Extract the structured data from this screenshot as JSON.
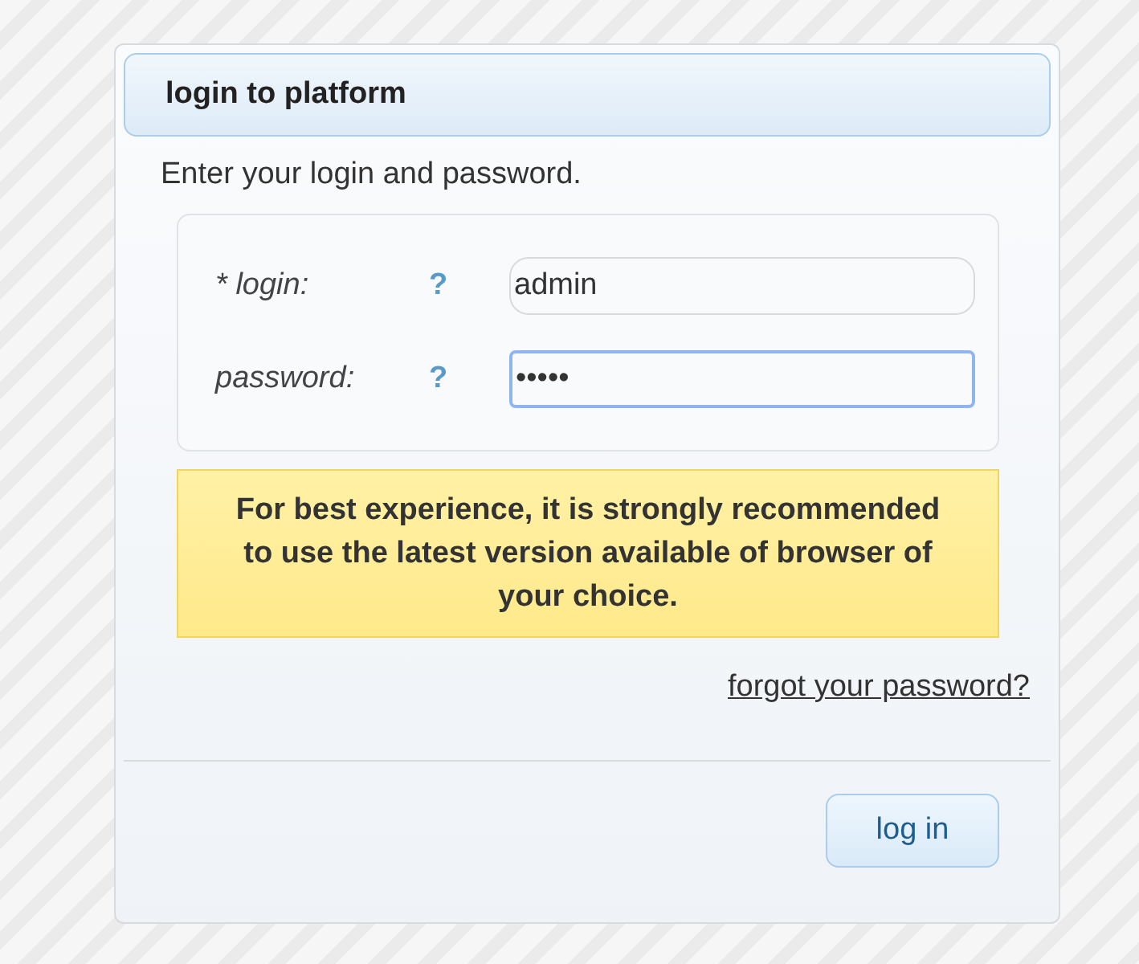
{
  "panel": {
    "title": "login to platform",
    "intro": "Enter your login and password."
  },
  "fields": [
    {
      "marker": "* ",
      "label": "login:",
      "help": "?",
      "value": "admin",
      "focused": false
    },
    {
      "label": "password:",
      "help": "?",
      "value": "•••••",
      "focused": true
    }
  ],
  "notice": "For best experience, it is strongly recommended to use the latest version available of browser of your choice.",
  "forgot_link": "forgot your password?",
  "buttons": [
    {
      "label": "log in"
    }
  ]
}
